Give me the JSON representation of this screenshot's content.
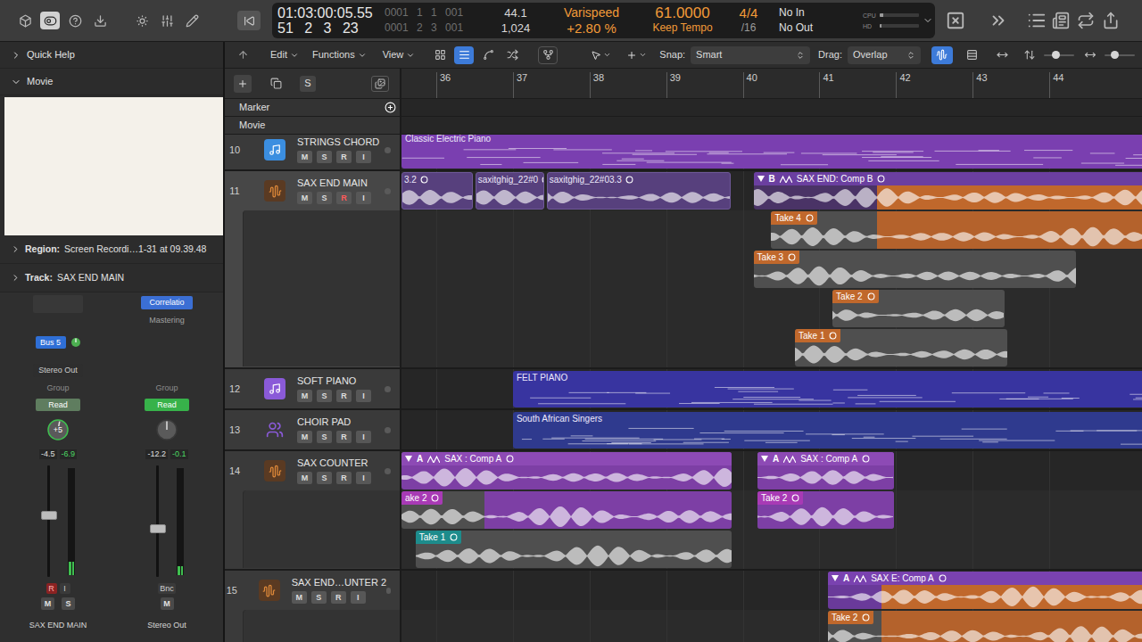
{
  "top_bar": {
    "left_buttons": [
      {
        "selected": false
      },
      {
        "selected": true
      },
      {
        "selected": false
      },
      {
        "selected": false
      },
      {
        "selected": false
      },
      {
        "selected": false
      },
      {
        "selected": false
      }
    ],
    "lcd": {
      "time": "01:03:00:05.55",
      "bars": "51 2 3 23",
      "locators": [
        "0001 1 1 001",
        "0001 2 3 001"
      ],
      "sample_rate": "44.1",
      "buffer": "1,024",
      "varispeed": {
        "label": "Varispeed",
        "value": "+2.80 %"
      },
      "tempo": {
        "value": "61.0000",
        "mode": "Keep Tempo"
      },
      "signature": {
        "value": "4/4",
        "division": "/16"
      },
      "input": "No In",
      "output": "No Out",
      "meters": [
        {
          "label": "CPU",
          "level": 0.08
        },
        {
          "label": "HD",
          "level": 0.04
        }
      ]
    }
  },
  "inspector": {
    "sections": [
      {
        "label": "Quick Help",
        "expanded": false
      },
      {
        "label": "Movie",
        "expanded": true
      }
    ],
    "region": {
      "label": "Region:",
      "value": "Screen Recordi…1-31 at 09.39.48",
      "expanded": false
    },
    "track": {
      "label": "Track:",
      "value": "SAX END MAIN",
      "expanded": false
    },
    "channel_strips": [
      {
        "name": "SAX END MAIN",
        "slots": [
          {
            "kind": "empty"
          }
        ],
        "send": {
          "label": "Bus 5",
          "level": 0.5
        },
        "output": "Stereo Out",
        "group": "Group",
        "automation": {
          "label": "Read",
          "color": "#5f7d5f"
        },
        "pan": "+5",
        "pan_level": 0.54,
        "volume": "-4.5",
        "peak": "-6.9",
        "fader_level": 0.56,
        "meter_level": 0.12,
        "buttons": [
          {
            "label": "R",
            "on": true
          },
          {
            "label": "I",
            "on": false
          }
        ],
        "mute_solo": [
          "M",
          "S"
        ]
      },
      {
        "name": "Stereo Out",
        "slots": [
          {
            "kind": "plugin",
            "label": "Correlatio"
          },
          {
            "kind": "text",
            "label": "Mastering"
          }
        ],
        "send": null,
        "output": null,
        "group": "Group",
        "automation": {
          "label": "Read",
          "color": "#37b24a"
        },
        "pan": "",
        "pan_level": 0.5,
        "volume": "-12.2",
        "peak": "-0.1",
        "fader_level": 0.43,
        "meter_level": 0.08,
        "buttons": [
          {
            "label": "Bnc",
            "on": false
          }
        ],
        "mute_solo": [
          "M"
        ]
      }
    ]
  },
  "toolbar": {
    "menus": [
      "Edit",
      "Functions",
      "View"
    ],
    "view_buttons": [
      {
        "selected": false
      },
      {
        "selected": true
      },
      {
        "selected": false
      },
      {
        "selected": false
      },
      {
        "selected": false
      }
    ],
    "snap": {
      "label": "Snap:",
      "value": "Smart"
    },
    "drag": {
      "label": "Drag:",
      "value": "Overlap"
    },
    "mode_buttons": [
      {
        "selected": true
      },
      {
        "selected": false
      },
      {
        "selected": false
      }
    ],
    "zoom_sliders": [
      {
        "level": 0.35
      },
      {
        "level": 0.3
      }
    ]
  },
  "header_bar": {
    "label": "S"
  },
  "ruler": {
    "bars": [
      "36",
      "37",
      "38",
      "39",
      "40",
      "41",
      "42",
      "43",
      "44"
    ]
  },
  "global_tracks": [
    {
      "label": "Marker",
      "addable": true
    },
    {
      "label": "Movie",
      "addable": false
    }
  ],
  "tracks": [
    {
      "number": "10",
      "name": "STRINGS CHORD",
      "kind": "instrument",
      "color": "#3b8ee0",
      "selected": false,
      "buttons": [
        {
          "label": "M",
          "on": false
        },
        {
          "label": "S",
          "on": false
        },
        {
          "label": "R",
          "on": false
        },
        {
          "label": "I",
          "on": false
        }
      ],
      "lanes": [
        {
          "kind": "main",
          "regions": [
            {
              "kind": "midi",
              "label": "Classic Electric Piano",
              "start": 35.546,
              "end": 45.5,
              "color": "#7a3fb0"
            }
          ]
        }
      ]
    },
    {
      "number": "11",
      "name": "SAX END MAIN",
      "kind": "audio",
      "color": "#e08a3a",
      "selected": true,
      "buttons": [
        {
          "label": "M",
          "on": false
        },
        {
          "label": "S",
          "on": false
        },
        {
          "label": "R",
          "on": true
        },
        {
          "label": "I",
          "on": false
        }
      ],
      "lanes": [
        {
          "kind": "main",
          "regions": [
            {
              "kind": "audio",
              "label": "3.2",
              "start": 35.546,
              "end": 36.48,
              "color": "#57407d"
            },
            {
              "kind": "audio",
              "label": "saxitghig_22#0",
              "start": 36.51,
              "end": 37.41,
              "color": "#57407d"
            },
            {
              "kind": "audio",
              "label": "saxitghig_22#03.3",
              "start": 37.44,
              "end": 39.84,
              "color": "#57407d"
            },
            {
              "kind": "comp",
              "tag": "B",
              "label": "SAX END: Comp B",
              "start": 40.14,
              "end": 45.5,
              "head_color": "#6b3fa0",
              "base_color": "#4a3366",
              "color": "#c0682c",
              "highlight_start": 41.75
            }
          ]
        },
        {
          "kind": "take",
          "regions": [
            {
              "kind": "take",
              "label": "Take 4",
              "start": 40.37,
              "end": 45.5,
              "tag_color": "#c0682c",
              "base_color": "#4f4f4f",
              "color": "#b4622c",
              "highlight_start": 41.75
            }
          ]
        },
        {
          "kind": "take",
          "regions": [
            {
              "kind": "take",
              "label": "Take 3",
              "start": 40.14,
              "end": 44.35,
              "tag_color": "#c0682c",
              "base_color": "#4f4f4f"
            }
          ]
        },
        {
          "kind": "take",
          "regions": [
            {
              "kind": "take",
              "label": "Take 2",
              "start": 41.17,
              "end": 43.42,
              "tag_color": "#c0682c",
              "base_color": "#4f4f4f"
            }
          ]
        },
        {
          "kind": "take",
          "regions": [
            {
              "kind": "take",
              "label": "Take 1",
              "start": 40.68,
              "end": 43.45,
              "tag_color": "#c0682c",
              "base_color": "#4f4f4f"
            }
          ]
        }
      ]
    },
    {
      "number": "12",
      "name": "SOFT PIANO",
      "kind": "instrument",
      "color": "#8a5ad8",
      "selected": false,
      "buttons": [
        {
          "label": "M",
          "on": false
        },
        {
          "label": "S",
          "on": false
        },
        {
          "label": "R",
          "on": false
        },
        {
          "label": "I",
          "on": false
        }
      ],
      "lanes": [
        {
          "kind": "main",
          "regions": [
            {
              "kind": "midi",
              "label": "FELT PIANO",
              "start": 37.0,
              "end": 45.5,
              "color": "#3834a0"
            }
          ]
        }
      ]
    },
    {
      "number": "13",
      "name": "CHOIR PAD",
      "kind": "choir",
      "color": "#8a5ad8",
      "selected": false,
      "buttons": [
        {
          "label": "M",
          "on": false
        },
        {
          "label": "S",
          "on": false
        },
        {
          "label": "R",
          "on": false
        },
        {
          "label": "I",
          "on": false
        }
      ],
      "lanes": [
        {
          "kind": "main",
          "regions": [
            {
              "kind": "midi",
              "label": "South African Singers",
              "start": 37.0,
              "end": 45.5,
              "color": "#2f3a8e"
            }
          ]
        }
      ]
    },
    {
      "number": "14",
      "name": "SAX COUNTER",
      "kind": "audio",
      "color": "#e08a3a",
      "selected": false,
      "buttons": [
        {
          "label": "M",
          "on": false
        },
        {
          "label": "S",
          "on": false
        },
        {
          "label": "R",
          "on": false
        },
        {
          "label": "I",
          "on": false
        }
      ],
      "lanes": [
        {
          "kind": "main",
          "regions": [
            {
              "kind": "comp",
              "tag": "A",
              "label": "SAX : Comp A",
              "start": 35.546,
              "end": 39.85,
              "head_color": "#8d4ab5",
              "color": "#7d3fa5"
            },
            {
              "kind": "comp",
              "tag": "A",
              "label": "SAX : Comp A",
              "start": 40.19,
              "end": 41.97,
              "head_color": "#8d4ab5",
              "color": "#7d3fa5"
            }
          ]
        },
        {
          "kind": "take",
          "regions": [
            {
              "kind": "take",
              "label": "ake 2",
              "start": 35.546,
              "end": 39.85,
              "tag_color": "#a83ab5",
              "base_color": "#4f4f4f",
              "color": "#7d3fa5",
              "highlight_start": 36.63
            },
            {
              "kind": "take",
              "label": "Take 2",
              "start": 40.19,
              "end": 41.97,
              "tag_color": "#a83ab5",
              "base_color": "#4f4f4f",
              "color": "#7d3fa5",
              "highlight_start": 40.19
            }
          ]
        },
        {
          "kind": "take",
          "regions": [
            {
              "kind": "take",
              "label": "Take 1",
              "start": 35.73,
              "end": 39.85,
              "tag_color": "#1d8c8c",
              "base_color": "#4f4f4f"
            }
          ]
        }
      ]
    },
    {
      "number": "15",
      "name": "SAX END…UNTER 2",
      "kind": "audio",
      "color": "#e08a3a",
      "selected": false,
      "buttons": [
        {
          "label": "M",
          "on": false
        },
        {
          "label": "S",
          "on": false
        },
        {
          "label": "R",
          "on": false
        },
        {
          "label": "I",
          "on": false
        }
      ],
      "lanes": [
        {
          "kind": "main",
          "regions": [
            {
              "kind": "comp",
              "tag": "A",
              "label": "SAX E: Comp A",
              "start": 41.11,
              "end": 45.5,
              "head_color": "#7a42b0",
              "base_color": "#6a3a9a",
              "color": "#c0682c",
              "highlight_start": 41.81
            }
          ]
        },
        {
          "kind": "take",
          "regions": [
            {
              "kind": "take",
              "label": "Take 2",
              "start": 41.11,
              "end": 45.5,
              "tag_color": "#c0682c",
              "base_color": "#4f4f4f",
              "color": "#b4622c",
              "highlight_start": 41.81
            }
          ]
        }
      ]
    }
  ]
}
